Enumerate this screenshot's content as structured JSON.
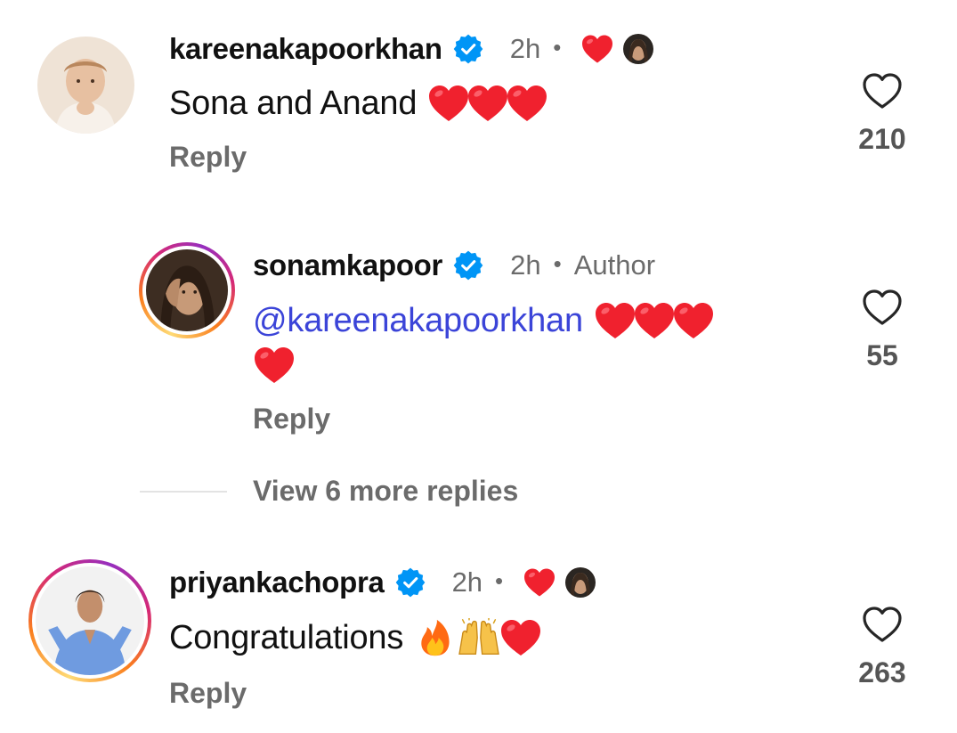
{
  "comments": [
    {
      "username": "kareenakapoorkhan",
      "time": "2h",
      "separator": "•",
      "text": "Sona and Anand",
      "emojis": [
        "red-heart",
        "red-heart",
        "red-heart"
      ],
      "reply_label": "Reply",
      "likes": "210",
      "liked_by_author": true
    },
    {
      "username": "sonamkapoor",
      "time": "2h",
      "separator": "•",
      "author_label": "Author",
      "mention": "@kareenakapoorkhan",
      "emojis": [
        "red-heart",
        "red-heart",
        "red-heart",
        "red-heart"
      ],
      "reply_label": "Reply",
      "likes": "55"
    },
    {
      "username": "priyankachopra",
      "time": "2h",
      "separator": "•",
      "text": "Congratulations",
      "emojis": [
        "fire",
        "raised-hands",
        "red-heart"
      ],
      "reply_label": "Reply",
      "likes": "263",
      "liked_by_author": true
    }
  ],
  "view_more_replies": "View 6 more replies",
  "colors": {
    "verified_blue": "#0095f6",
    "heart_red": "#ff3040",
    "mention_blue": "#3b44d8",
    "secondary_text": "#6b6b6b"
  }
}
